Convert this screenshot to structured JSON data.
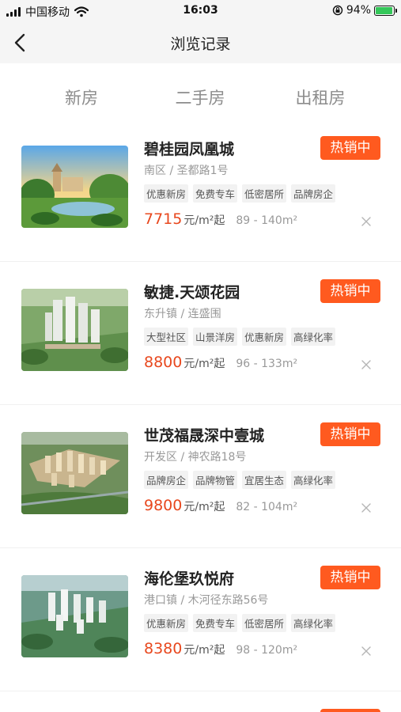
{
  "status_bar": {
    "carrier": "中国移动",
    "time": "16:03",
    "battery_percent": "94%",
    "battery_level": 0.94,
    "icons": [
      "signal-icon",
      "wifi-icon",
      "orientation-lock-icon",
      "battery-charging-icon"
    ]
  },
  "nav": {
    "title": "浏览记录",
    "back_icon": "chevron-left-icon"
  },
  "tabs": [
    {
      "label": "新房"
    },
    {
      "label": "二手房"
    },
    {
      "label": "出租房"
    }
  ],
  "colors": {
    "accent": "#ff5a1f",
    "price": "#e8481e",
    "tab_text": "#8c8c8c",
    "nav_bg": "#f5f5f5"
  },
  "listings": [
    {
      "name": "碧桂园凤凰城",
      "badge": "热销中",
      "location": "南区 / 圣都路1号",
      "tags": [
        "优惠新房",
        "免费专车",
        "低密居所",
        "品牌房企"
      ],
      "price": "7715",
      "unit": "元/m²起",
      "area": "89 - 140m²"
    },
    {
      "name": "敏捷.天颂花园",
      "badge": "热销中",
      "location": "东升镇 / 连盛围",
      "tags": [
        "大型社区",
        "山景洋房",
        "优惠新房",
        "高绿化率"
      ],
      "price": "8800",
      "unit": "元/m²起",
      "area": "96 - 133m²"
    },
    {
      "name": "世茂福晟深中壹城",
      "badge": "热销中",
      "location": "开发区 / 神农路18号",
      "tags": [
        "品牌房企",
        "品牌物管",
        "宜居生态",
        "高绿化率"
      ],
      "price": "9800",
      "unit": "元/m²起",
      "area": "82 - 104m²"
    },
    {
      "name": "海伦堡玖悦府",
      "badge": "热销中",
      "location": "港口镇 / 木河径东路56号",
      "tags": [
        "优惠新房",
        "免费专车",
        "低密居所",
        "高绿化率"
      ],
      "price": "8380",
      "unit": "元/m²起",
      "area": "98 - 120m²"
    }
  ]
}
